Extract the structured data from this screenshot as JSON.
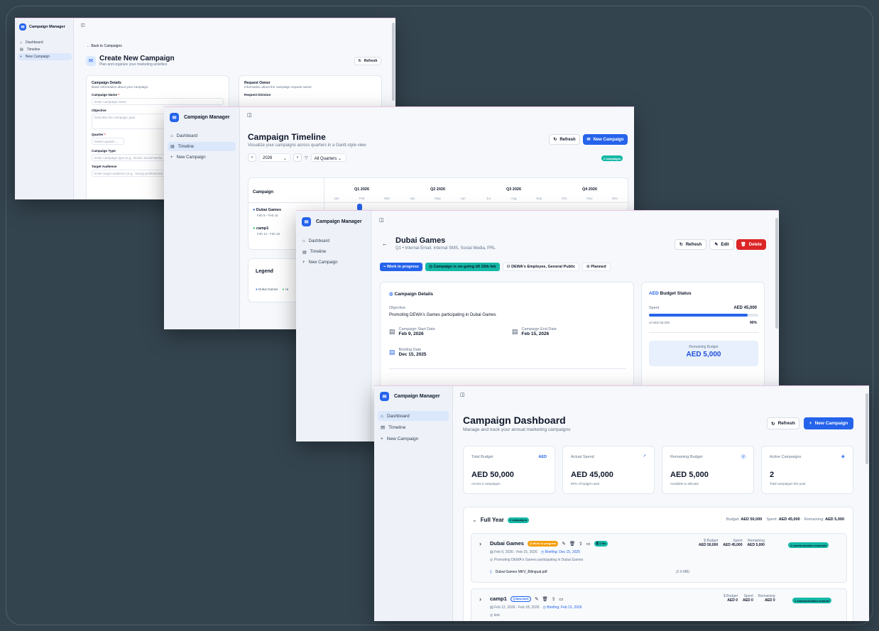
{
  "colors": {
    "accent": "#2563eb",
    "danger": "#dc2626",
    "teal": "#14b8a6",
    "warning": "#f59e0b",
    "bg": "#34444f"
  },
  "app": {
    "name": "Campaign Manager",
    "nav": [
      "Dashboard",
      "Timeline",
      "New Campaign"
    ]
  },
  "create": {
    "back": "Back to Campaigns",
    "title": "Create New Campaign",
    "subtitle": "Plan and organize your marketing activities",
    "refresh": "Refresh",
    "details_title": "Campaign Details",
    "details_sub": "Basic information about your campaign",
    "name_label": "Campaign Name",
    "required": "*",
    "name_placeholder": "Enter campaign name",
    "objective_label": "Objective",
    "objective_placeholder": "Describe the campaign goal",
    "quarter_label": "Quarter",
    "quarter_placeholder": "Select quarter",
    "type_label": "Campaign Type",
    "type_placeholder": "Enter campaign type (e.g., Email, Social Media",
    "audience_label": "Target Audience",
    "audience_placeholder": "Enter target audience (e.g., Young professional",
    "owner_title": "Request Owner",
    "owner_sub": "Information about the campaign request owner",
    "division_label": "Request Division"
  },
  "timeline": {
    "title": "Campaign Timeline",
    "subtitle": "Visualize your campaigns across quarters in a Gantt-style view",
    "refresh": "Refresh",
    "new_campaign": "New Campaign",
    "year": "2026",
    "quarter_filter": "All Quarters",
    "count_badge": "2 campaigns",
    "campaign_col": "Campaign",
    "quarters": [
      "Q1 2026",
      "Q2 2026",
      "Q3 2026",
      "Q4 2026"
    ],
    "months": [
      "Jan",
      "Feb",
      "Mar",
      "Apr",
      "May",
      "Jun",
      "Jul",
      "Aug",
      "Sep",
      "Oct",
      "Nov",
      "Dec"
    ],
    "campaigns": [
      {
        "name": "Dubai Games",
        "dates": "Feb 9 - Feb 15"
      },
      {
        "name": "camp1",
        "dates": "Feb 12 - Feb 18"
      }
    ],
    "legend_title": "Legend",
    "legend_items": [
      "Dubai Games",
      "ca"
    ]
  },
  "detail": {
    "title": "Dubai Games",
    "quarter": "Q1",
    "sep": "•",
    "channels": "Internal Email, Internal SMS, Social Media, PRL",
    "refresh": "Refresh",
    "edit": "Edit",
    "delete": "Delete",
    "status_badge": "Work in progress",
    "ongoing_badge": "Campaign is on-going till 15th feb",
    "audience": "DEWA's Employee, General Public",
    "planned": "Planned",
    "details_title": "Campaign Details",
    "objective_label": "Objective",
    "objective": "Promoting DEWA's Games participating in Dubai Games",
    "start_label": "Campaign Start Date",
    "start": "Feb 9, 2026",
    "end_label": "Campaign End Date",
    "end": "Feb 15, 2026",
    "briefing_label": "Briefing Date",
    "briefing": "Dec 15, 2025",
    "budget_prefix": "AED",
    "budget_title": "Budget Status",
    "spent_label": "Spent",
    "spent_value": "AED 45,000",
    "of_label": "of AED 50,000",
    "percent": "90%",
    "spent_fraction": 0.9,
    "remaining_label": "Remaining Budget",
    "remaining_value": "AED 5,000"
  },
  "dashboard": {
    "title": "Campaign Dashboard",
    "subtitle": "Manage and track your annual marketing campaigns",
    "refresh": "Refresh",
    "new_campaign": "New Campaign",
    "stats": [
      {
        "label": "Total Budget",
        "icon_text": "AED",
        "value": "AED 50,000",
        "sub": "Across 2 campaigns"
      },
      {
        "label": "Actual Spend",
        "icon_text": "",
        "value": "AED 45,000",
        "sub": "90% of budget used"
      },
      {
        "label": "Remaining Budget",
        "icon_text": "",
        "value": "AED 5,000",
        "sub": "Available to allocate"
      },
      {
        "label": "Active Campaigns",
        "icon_text": "",
        "value": "2",
        "sub": "Total campaigns this year"
      }
    ],
    "section": {
      "title": "Full Year",
      "badge": "2 campaigns",
      "budget_label": "Budget:",
      "budget_value": "AED 50,000",
      "spent_label": "Spent:",
      "spent_value": "AED 45,000",
      "remaining_label": "Remaining:",
      "remaining_value": "AED 5,000"
    },
    "campaigns": [
      {
        "name": "Dubai Games",
        "status": "Work in progress",
        "file_count": "1 file",
        "dates": "Feb 9, 2026 - Feb 15, 2026",
        "briefing": "Briefing: Dec 15, 2025",
        "objective": "Promoting DEWA's Games participating in Dubai Games",
        "file_name": "Dubai Games MKV_Bilingual.pdf",
        "file_size": "(2.9 MB)",
        "budget_label": "$ Budget",
        "spent_label": "Spent",
        "remaining_label": "Remaining",
        "budget": "AED 50,000",
        "spent": "AED 45,000",
        "remaining": "AED 5,000",
        "channels": "4 communication channels"
      },
      {
        "name": "camp1",
        "status": "New brief",
        "file_count": "",
        "dates": "Feb 12, 2026 - Feb 18, 2026",
        "briefing": "Briefing: Feb 13, 2026",
        "objective": "test",
        "file_name": "",
        "file_size": "",
        "budget_label": "$ Budget",
        "spent_label": "Spent",
        "remaining_label": "Remaining",
        "budget": "AED 0",
        "spent": "AED 0",
        "remaining": "AED 0",
        "channels": "1 communication channel"
      }
    ]
  }
}
